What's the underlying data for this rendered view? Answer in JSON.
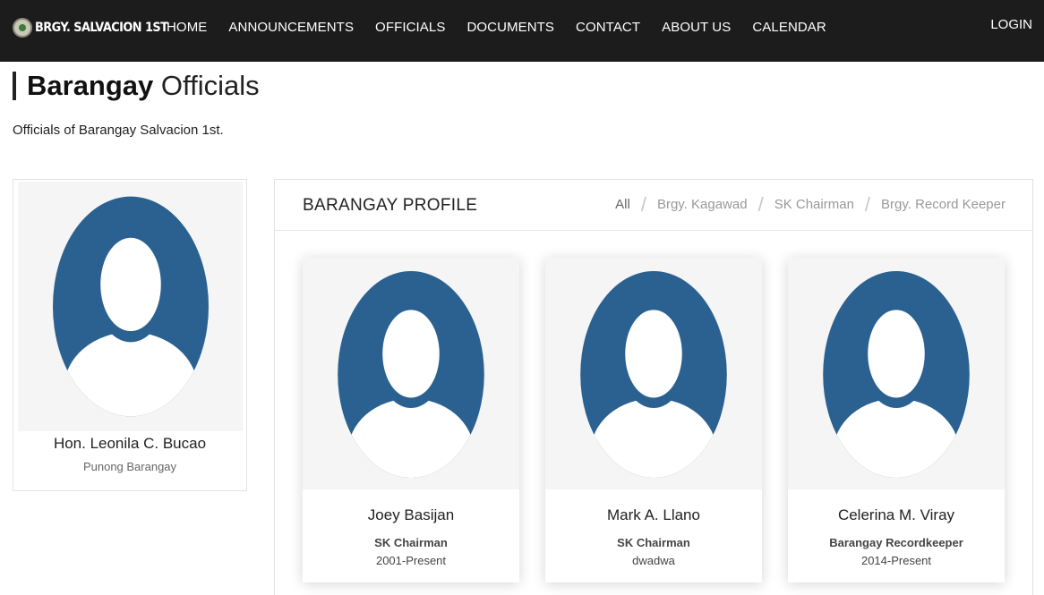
{
  "brand": {
    "text": "BRGY. SALVACION 1ST",
    "logo": "barangay-seal-icon"
  },
  "nav": {
    "items": [
      {
        "label": "HOME"
      },
      {
        "label": "ANNOUNCEMENTS"
      },
      {
        "label": "OFFICIALS"
      },
      {
        "label": "DOCUMENTS"
      },
      {
        "label": "CONTACT"
      },
      {
        "label": "ABOUT US"
      },
      {
        "label": "CALENDAR"
      }
    ],
    "login_label": "LOGIN"
  },
  "page": {
    "title_strong": "Barangay",
    "title_light": "Officials",
    "subtitle": "Officials of Barangay Salvacion 1st."
  },
  "captain": {
    "name": "Hon. Leonila C. Bucao",
    "role": "Punong Barangay",
    "photo_icon": "user-avatar-icon"
  },
  "profile": {
    "title": "BARANGAY PROFILE",
    "filters": [
      {
        "label": "All"
      },
      {
        "label": "Brgy. Kagawad"
      },
      {
        "label": "SK Chairman"
      },
      {
        "label": "Brgy. Record Keeper"
      }
    ],
    "officials": [
      {
        "name": "Joey Basijan",
        "position": "SK Chairman",
        "term": "2001-Present"
      },
      {
        "name": "Mark A. Llano",
        "position": "SK Chairman",
        "term": "dwadwa"
      },
      {
        "name": "Celerina M. Viray",
        "position": "Barangay Recordkeeper",
        "term": "2014-Present"
      }
    ]
  },
  "colors": {
    "navbar_bg": "#1c1c1c",
    "avatar_blue": "#2b6190",
    "photo_bg": "#f5f5f5"
  }
}
